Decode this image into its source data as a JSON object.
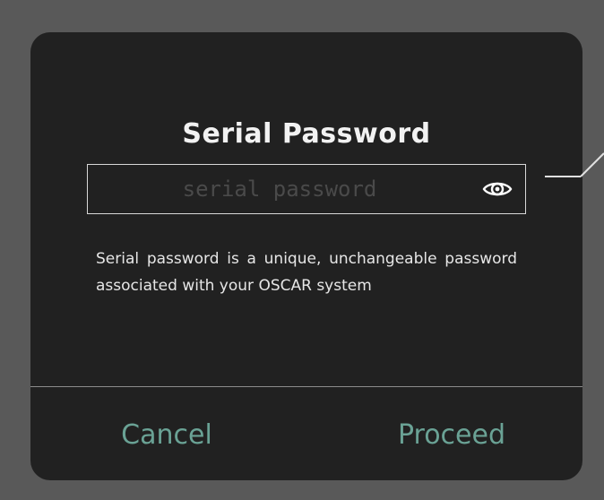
{
  "dialog": {
    "title": "Serial Password",
    "password": {
      "placeholder": "serial password",
      "value": "",
      "toggle_icon": "eye-icon"
    },
    "description": "Serial password is a unique, unchangeable password associated with your OSCAR system",
    "buttons": {
      "cancel": "Cancel",
      "proceed": "Proceed"
    }
  },
  "colors": {
    "backdrop": "#595959",
    "dialog_background": "#212121",
    "accent": "#6aa295",
    "text": "#e6e6e6"
  }
}
